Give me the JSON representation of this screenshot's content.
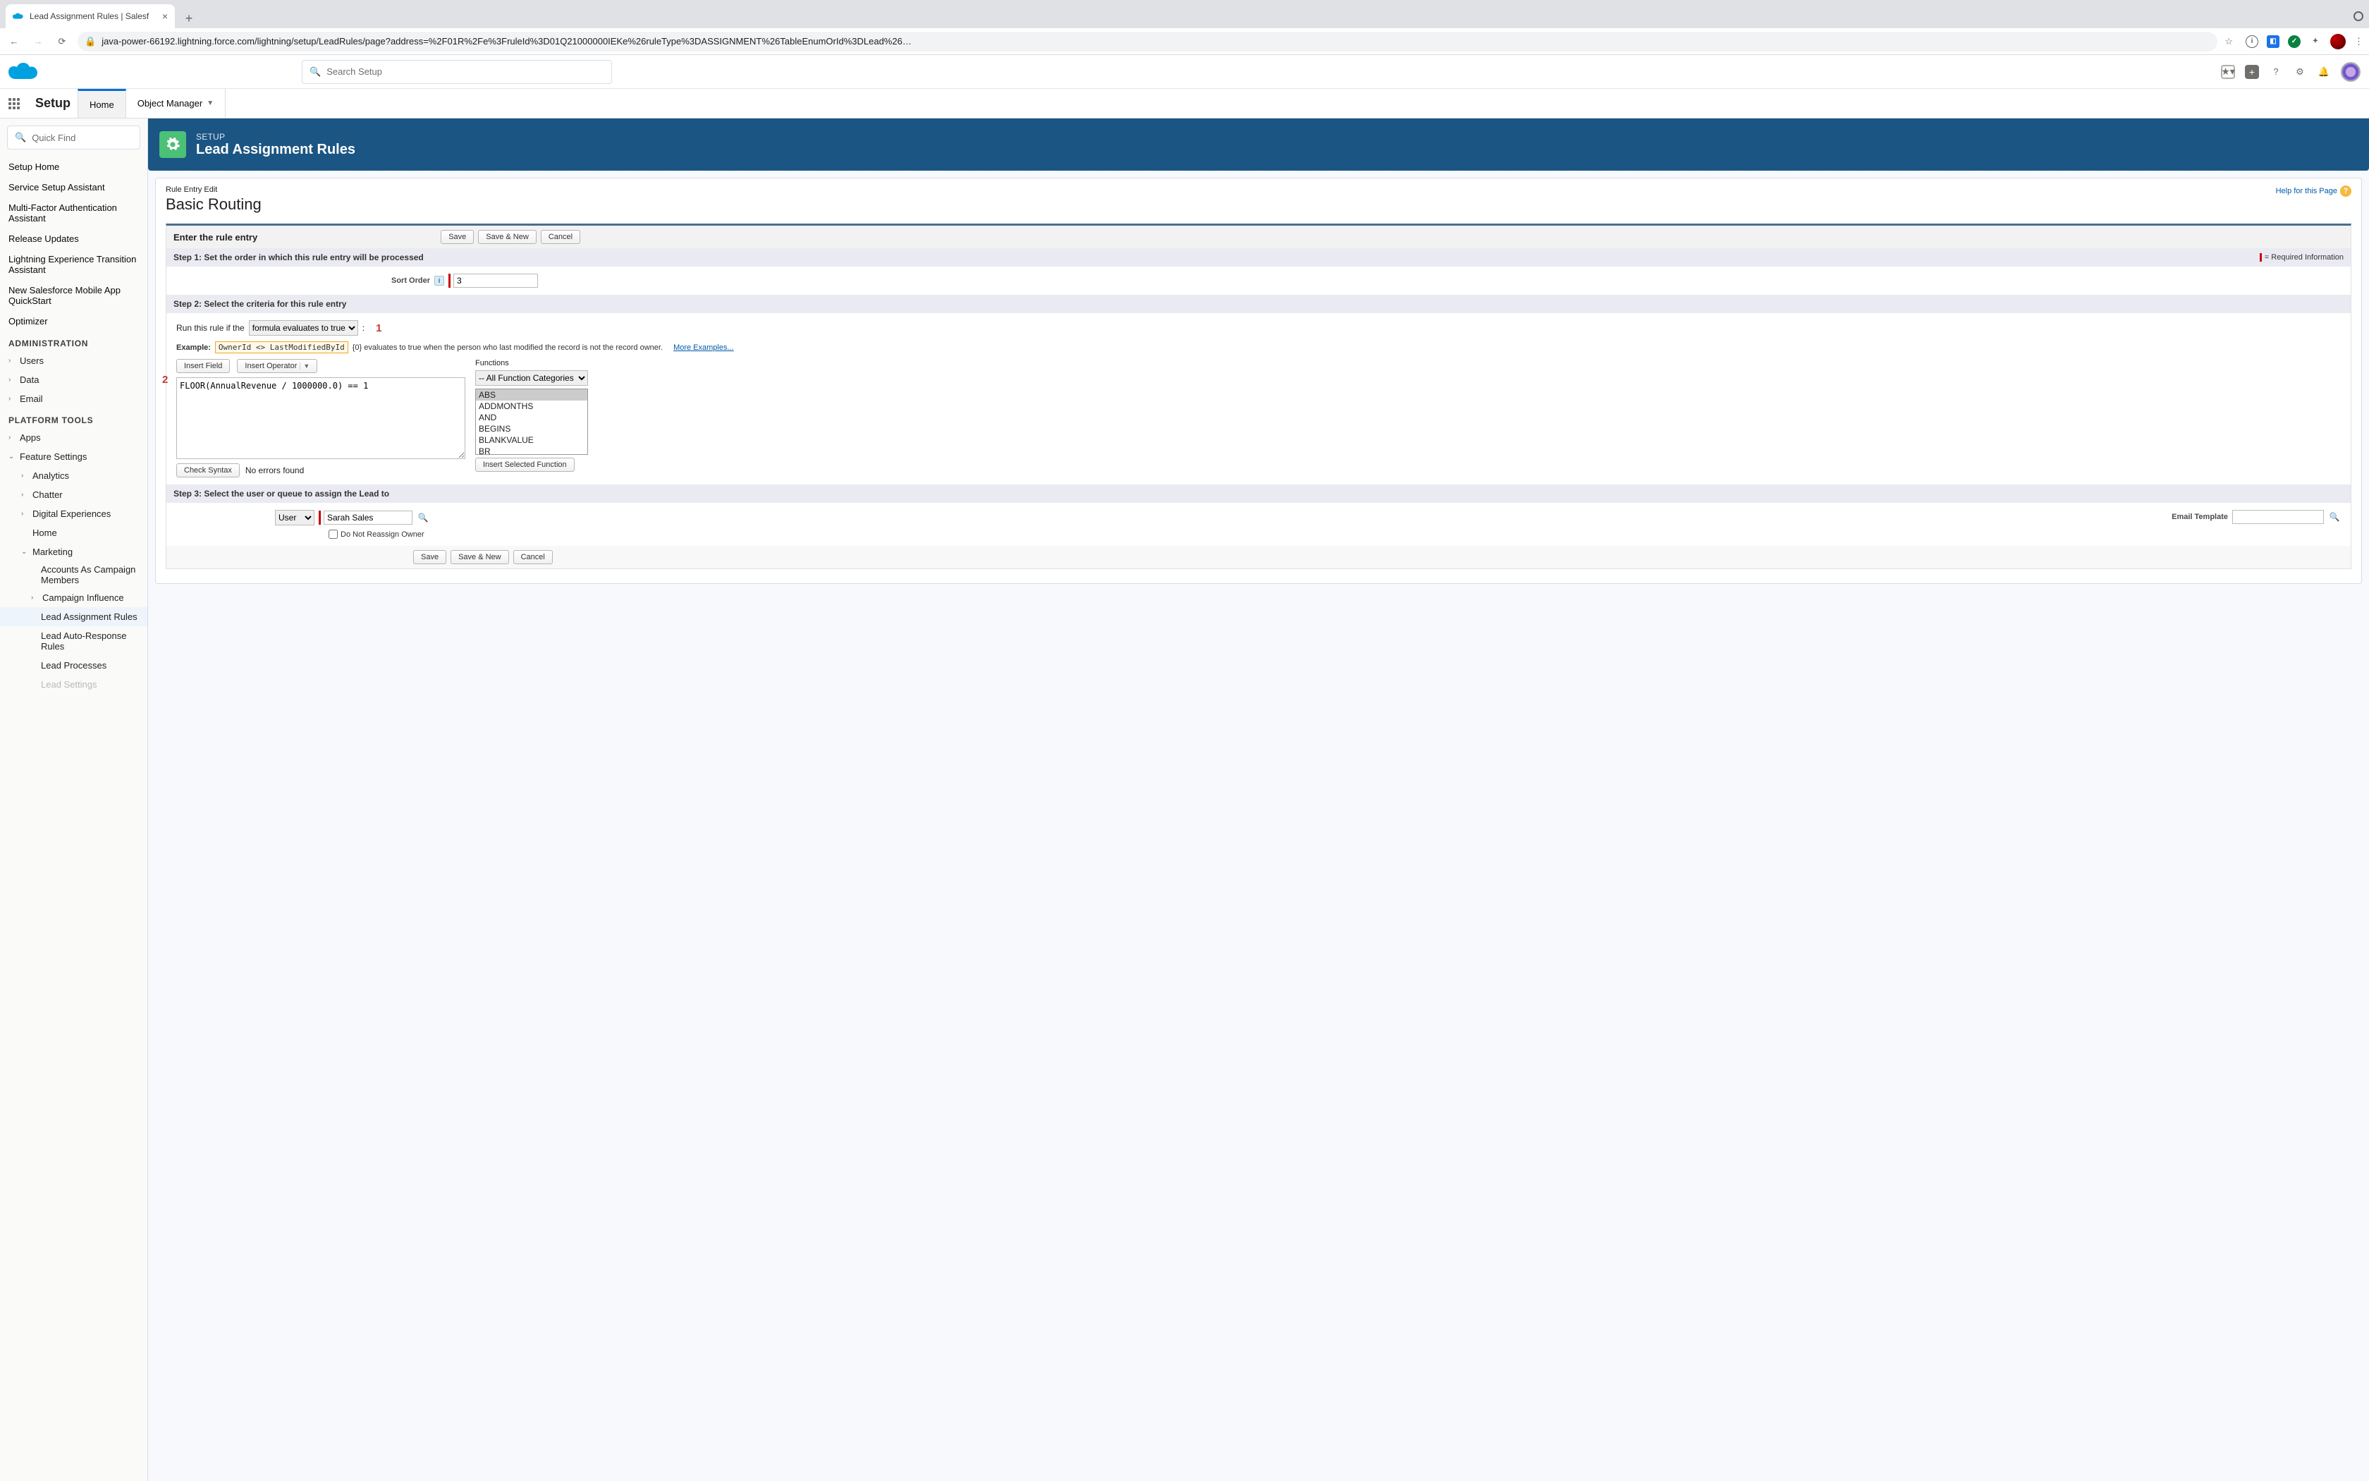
{
  "browser": {
    "tabTitle": "Lead Assignment Rules | Salesf",
    "url": "java-power-66192.lightning.force.com/lightning/setup/LeadRules/page?address=%2F01R%2Fe%3FruleId%3D01Q21000000IEKe%26ruleType%3DASSIGNMENT%26TableEnumOrId%3DLead%26…"
  },
  "globalSearch": {
    "placeholder": "Search Setup"
  },
  "setup": {
    "label": "Setup",
    "tabs": {
      "home": "Home",
      "objectManager": "Object Manager"
    }
  },
  "quickFind": {
    "placeholder": "Quick Find"
  },
  "sidebar": {
    "top": [
      "Setup Home",
      "Service Setup Assistant",
      "Multi-Factor Authentication Assistant",
      "Release Updates",
      "Lightning Experience Transition Assistant",
      "New Salesforce Mobile App QuickStart",
      "Optimizer"
    ],
    "adminHead": "ADMINISTRATION",
    "admin": [
      "Users",
      "Data",
      "Email"
    ],
    "platHead": "PLATFORM TOOLS",
    "apps": "Apps",
    "feature": "Feature Settings",
    "featureChildren": [
      "Analytics",
      "Chatter",
      "Digital Experiences",
      "Home"
    ],
    "marketing": "Marketing",
    "marketingChildren": [
      "Accounts As Campaign Members",
      "Campaign Influence",
      "Lead Assignment Rules",
      "Lead Auto-Response Rules",
      "Lead Processes",
      "Lead Settings"
    ]
  },
  "pageHeader": {
    "eyebrow": "SETUP",
    "title": "Lead Assignment Rules"
  },
  "card": {
    "crumb": "Rule Entry Edit",
    "title": "Basic Routing",
    "help": "Help for this Page"
  },
  "buttons": {
    "save": "Save",
    "saveNew": "Save & New",
    "cancel": "Cancel",
    "insertField": "Insert Field",
    "insertOperator": "Insert Operator",
    "insertSelected": "Insert Selected Function",
    "checkSyntax": "Check Syntax"
  },
  "section": {
    "enter": "Enter the rule entry",
    "required": "= Required Information",
    "step1": "Step 1: Set the order in which this rule entry will be processed",
    "step2": "Step 2: Select the criteria for this rule entry",
    "step3": "Step 3: Select the user or queue to assign the Lead to"
  },
  "step1": {
    "label": "Sort Order",
    "value": "3"
  },
  "step2": {
    "runLabel": "Run this rule if the",
    "runSelect": "formula evaluates to true",
    "colon": ":",
    "exampleLabel": "Example:",
    "exampleCode": "OwnerId <> LastModifiedById",
    "exampleText": "{0} evaluates to true when the person who last modified the record is not the record owner.",
    "moreExamples": "More Examples...",
    "formula": "FLOOR(AnnualRevenue / 1000000.0) == 1",
    "syntaxResult": "No errors found",
    "functionsLabel": "Functions",
    "functionCategory": "-- All Function Categories --",
    "functions": [
      "ABS",
      "ADDMONTHS",
      "AND",
      "BEGINS",
      "BLANKVALUE",
      "BR"
    ],
    "callout1": "1",
    "callout2": "2"
  },
  "step3": {
    "assignType": "User",
    "assignValue": "Sarah Sales",
    "emailTemplateLabel": "Email Template",
    "emailTemplateValue": "",
    "doNotReassign": "Do Not Reassign Owner"
  }
}
